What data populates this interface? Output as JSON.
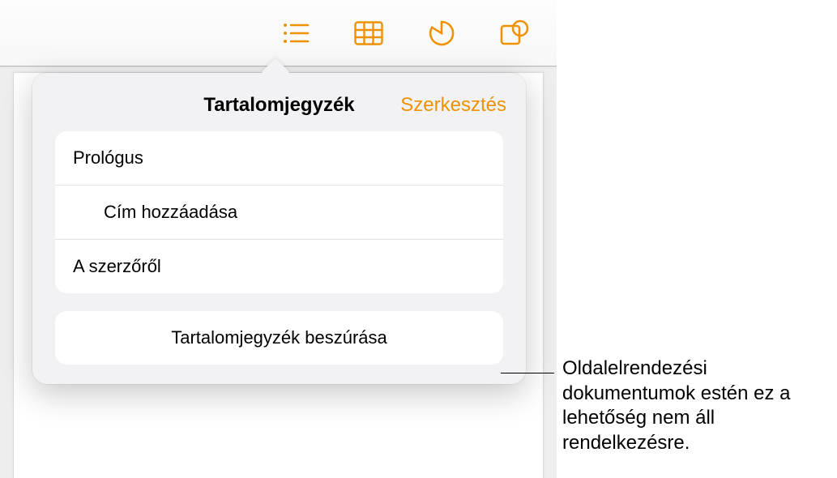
{
  "accent": "#ee9203",
  "toolbar": {
    "buttons": [
      {
        "name": "toc-view-icon"
      },
      {
        "name": "table-insert-icon"
      },
      {
        "name": "chart-insert-icon"
      },
      {
        "name": "shape-insert-icon"
      }
    ]
  },
  "popover": {
    "title": "Tartalomjegyzék",
    "edit": "Szerkesztés",
    "items": [
      {
        "label": "Prológus",
        "indent": false
      },
      {
        "label": "Cím hozzáadása",
        "indent": true
      },
      {
        "label": "A szerzőről",
        "indent": false
      }
    ],
    "insert_button": "Tartalomjegyzék beszúrása"
  },
  "callout": "Oldalelrendezési dokumentumok estén ez a lehetőség nem áll rendelkezésre."
}
